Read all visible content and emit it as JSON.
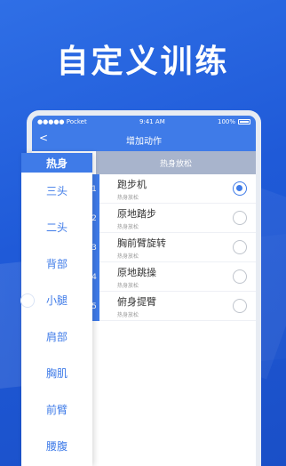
{
  "headline": "自定义训练",
  "statusbar": {
    "carrier": "●●●●● Pocket",
    "wifi": "wifi-icon",
    "time": "9:41 AM",
    "battery": "100%"
  },
  "navbar": {
    "back": "<",
    "title": "增加动作"
  },
  "subheader": "热身放松",
  "rows": [
    {
      "num": "1",
      "name": "跑步机",
      "sub": "热身放松",
      "selected": true
    },
    {
      "num": "2",
      "name": "原地踏步",
      "sub": "热身放松",
      "selected": false
    },
    {
      "num": "3",
      "name": "胸前臂旋转",
      "sub": "热身放松",
      "selected": false
    },
    {
      "num": "4",
      "name": "原地跳操",
      "sub": "热身放松",
      "selected": false
    },
    {
      "num": "5",
      "name": "俯身提臂",
      "sub": "热身放松",
      "selected": false
    }
  ],
  "sidemenu": {
    "header": "热身",
    "items": [
      "三头",
      "二头",
      "背部",
      "小腿",
      "肩部",
      "胸肌",
      "前臂",
      "腰腹"
    ]
  },
  "colors": {
    "accent": "#3f7be8",
    "background": "#1f5ad8"
  }
}
